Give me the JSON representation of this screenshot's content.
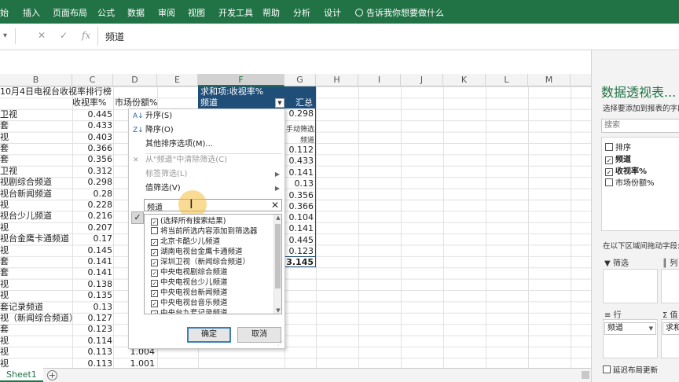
{
  "ribbon": {
    "tabs": [
      "始",
      "插入",
      "页面布局",
      "公式",
      "数据",
      "审阅",
      "视图",
      "开发工具",
      "帮助",
      "分析",
      "设计"
    ],
    "tell_me": "告诉我你想要做什么",
    "color": "#217346"
  },
  "formula_bar": {
    "cancel": "✕",
    "enter": "✓",
    "fx": "fx",
    "value": "频道"
  },
  "columns": [
    "B",
    "C",
    "D",
    "E",
    "F",
    "G",
    "H",
    "I",
    "J",
    "K",
    "L",
    "M"
  ],
  "sheet": {
    "title": "10月4日电视台收视率排行榜",
    "col_c_header": "收视率%",
    "col_d_header": "市场份额%",
    "rows": [
      {
        "name": "卫视",
        "rating": "0.445"
      },
      {
        "name": "套",
        "rating": "0.433"
      },
      {
        "name": "视",
        "rating": "0.403"
      },
      {
        "name": "套",
        "rating": "0.366"
      },
      {
        "name": "套",
        "rating": "0.356"
      },
      {
        "name": "卫视",
        "rating": "0.312"
      },
      {
        "name": "视剧综合频道",
        "rating": "0.298"
      },
      {
        "name": "视台新闻频道",
        "rating": "0.28"
      },
      {
        "name": "视",
        "rating": "0.228"
      },
      {
        "name": "视台少儿频道",
        "rating": "0.216"
      },
      {
        "name": "视",
        "rating": "0.207"
      },
      {
        "name": "视台金鹰卡通频道",
        "rating": "0.17"
      },
      {
        "name": "视",
        "rating": "0.145"
      },
      {
        "name": "套",
        "rating": "0.141"
      },
      {
        "name": "套",
        "rating": "0.141"
      },
      {
        "name": "视",
        "rating": "0.138"
      },
      {
        "name": "视",
        "rating": "0.135"
      },
      {
        "name": "套记录频道",
        "rating": "0.13"
      },
      {
        "name": "视（新闻综合频道）",
        "rating": "0.127"
      },
      {
        "name": "套",
        "rating": "0.123"
      },
      {
        "name": "视",
        "rating": "0.114"
      },
      {
        "name": "视",
        "rating": "0.113",
        "share": "1.004"
      },
      {
        "name": "视",
        "rating": "0.113",
        "share": "1.001"
      }
    ]
  },
  "pivot": {
    "title_cell": "求和项:收视率%",
    "row_label": "频道",
    "total_label": "汇总",
    "values": [
      "0.298",
      "0.112",
      "0.433",
      "0.141",
      "0.13",
      "0.356",
      "0.366",
      "0.104",
      "0.141",
      "0.445",
      "0.123"
    ],
    "mini_text_1": "手动筛选",
    "mini_text_2": "频道",
    "grand_total": "3.145",
    "header_color": "#1f4e79"
  },
  "filter_menu": {
    "items": [
      {
        "label": "升序(S)",
        "icon": "sort-ascending-icon"
      },
      {
        "label": "降序(O)",
        "icon": "sort-descending-icon"
      },
      {
        "label": "其他排序选项(M)..."
      },
      {
        "label": "从\"频道\"中清除筛选(C)",
        "icon": "clear-filter-icon"
      },
      {
        "label": "标签筛选(L)"
      },
      {
        "label": "值筛选(V)"
      }
    ],
    "search_value": "频道",
    "clear_glyph": "✕",
    "list": [
      {
        "label": "(选择所有搜索结果)",
        "checked": true
      },
      {
        "label": "将当前所选内容添加到筛选器",
        "checked": false
      },
      {
        "label": "北京卡酷少儿频道",
        "checked": true
      },
      {
        "label": "湖南电视台金鹰卡通频道",
        "checked": true
      },
      {
        "label": "深圳卫视（新闻综合频道）",
        "checked": true
      },
      {
        "label": "中央电视剧综合频道",
        "checked": true
      },
      {
        "label": "中央电视台少儿频道",
        "checked": true
      },
      {
        "label": "中央电视台新闻频道",
        "checked": true
      },
      {
        "label": "中央电视台音乐频道",
        "checked": true
      },
      {
        "label": "中央台九套记录频道",
        "checked": true
      }
    ],
    "ok": "确定",
    "cancel": "取消"
  },
  "sheet_tab": "Sheet1",
  "add_sheet": "+",
  "pane": {
    "title": "数据透视表...",
    "subtitle": "选择要添加到报表的字段:",
    "search_placeholder": "搜索",
    "fields": [
      {
        "label": "排序",
        "checked": false
      },
      {
        "label": "频道",
        "checked": true
      },
      {
        "label": "收视率%",
        "checked": true
      },
      {
        "label": "市场份额%",
        "checked": false
      }
    ],
    "drag_label": "在以下区域间拖动字段:",
    "filter_area": "筛选",
    "col_area": "列",
    "row_area": "行",
    "value_area": "值",
    "row_chip": "频道",
    "value_chip": "求和",
    "defer": "延迟布局更新"
  }
}
